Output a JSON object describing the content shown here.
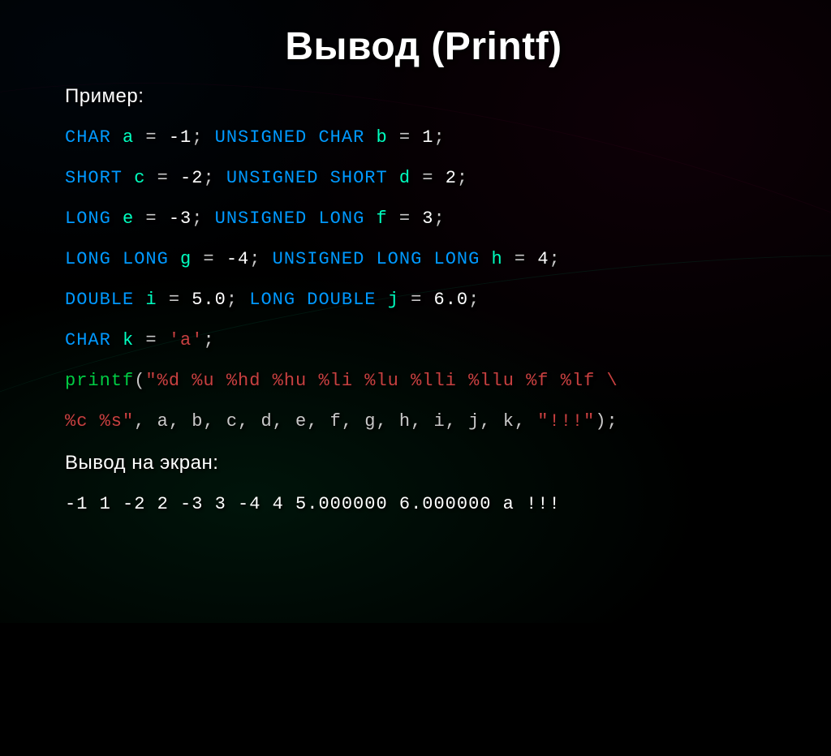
{
  "title": "Вывод (Printf)",
  "labels": {
    "example": "Пример:",
    "output_label": "Вывод на экран:"
  },
  "code": {
    "l1": {
      "t1": "char",
      "v1": "a",
      "eq1": " = ",
      "n1": "-1",
      "s1": "; ",
      "t2": "unsigned char",
      "v2": "b",
      "eq2": " = ",
      "n2": "1",
      "s2": ";"
    },
    "l2": {
      "t1": "short",
      "v1": "c",
      "eq1": " = ",
      "n1": "-2",
      "s1": "; ",
      "t2": "unsigned short",
      "v2": "d",
      "eq2": " = ",
      "n2": "2",
      "s2": ";"
    },
    "l3": {
      "t1": "long",
      "v1": "e",
      "eq1": " = ",
      "n1": "-3",
      "s1": "; ",
      "t2": "unsigned long",
      "v2": "f",
      "eq2": " = ",
      "n2": "3",
      "s2": ";"
    },
    "l4": {
      "t1": "long long",
      "v1": "g",
      "eq1": " = ",
      "n1": "-4",
      "s1": "; ",
      "t2": "unsigned long long",
      "v2": "h",
      "eq2": " = ",
      "n2": "4",
      "s2": ";"
    },
    "l5": {
      "t1": "double",
      "v1": "i",
      "eq1": " = ",
      "n1": "5.0",
      "s1": "; ",
      "t2": "long double",
      "v2": "j",
      "eq2": " = ",
      "n2": "6.0",
      "s2": ";"
    },
    "l6": {
      "t1": "char",
      "v1": "k",
      "eq1": " = ",
      "n1": "'a'",
      "s1": ";"
    },
    "printf": {
      "fn": "printf",
      "open": "(",
      "fmt1": "\"%d %u %hd %hu %li %lu %lli %llu %f %lf \\",
      "fmt2": "%c %s\"",
      "args": ", a, b, c, d, e, f, g, h, i, j, k, ",
      "lit": "\"!!!\"",
      "close": ");"
    }
  },
  "output": "-1 1 -2 2 -3 3 -4 4 5.000000 6.000000 a !!!"
}
